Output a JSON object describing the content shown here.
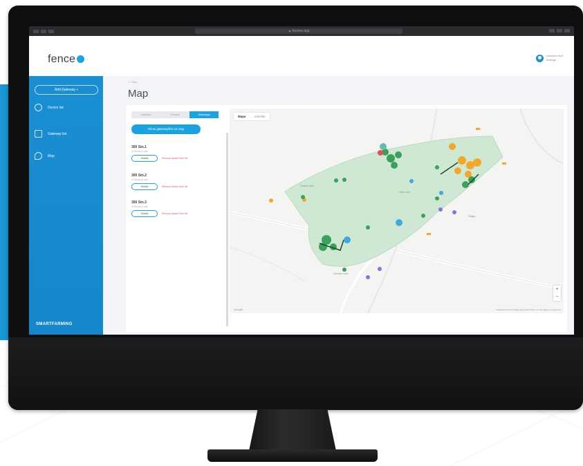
{
  "browser": {
    "url": "▲ fencee.app"
  },
  "header": {
    "logo_text": "fence",
    "user_name": "vaultsecurity5",
    "user_role": "Settings"
  },
  "sidebar": {
    "gateway_button": "Add Gateway  +",
    "items": [
      {
        "label": "Device list",
        "icon": "gear-icon"
      },
      {
        "label": "Gateway list",
        "icon": "folder-icon"
      },
      {
        "label": "Map",
        "icon": "map-pin-icon"
      }
    ],
    "brand": "SMARTFARMING"
  },
  "main": {
    "breadcrumb": "⌂  ›  Map",
    "title": "Map"
  },
  "panel": {
    "tabs": [
      {
        "label": "Devices",
        "active": false
      },
      {
        "label": "Groups",
        "active": false
      },
      {
        "label": "Gateways",
        "active": true
      }
    ],
    "show_button": "Show gateway/list on map",
    "herds": [
      {
        "name": "300 Stn.1",
        "sub": "0 Pieces in use",
        "button": "Details",
        "remove": "Remove device from list"
      },
      {
        "name": "300 Stn.2",
        "sub": "0 Pieces in use",
        "button": "Details",
        "remove": "Remove device from list"
      },
      {
        "name": "300 Stn.3",
        "sub": "0 Pieces in use",
        "button": "Details",
        "remove": "Remove device from list"
      }
    ]
  },
  "map": {
    "tabs": [
      {
        "label": "Maps",
        "active": true
      },
      {
        "label": "Satellite",
        "active": false
      }
    ],
    "zoom_in": "+",
    "zoom_out": "−",
    "google": "Google",
    "footer": "Keyboard shortcuts   Map data ©2022   Terms of Use   Report a map error",
    "colors": {
      "green_pin": "#3aa15c",
      "orange_pin": "#f3a72b",
      "blue_pin": "#3fa9e4",
      "red_pin": "#e05050",
      "area": "#cfe8d4"
    }
  }
}
